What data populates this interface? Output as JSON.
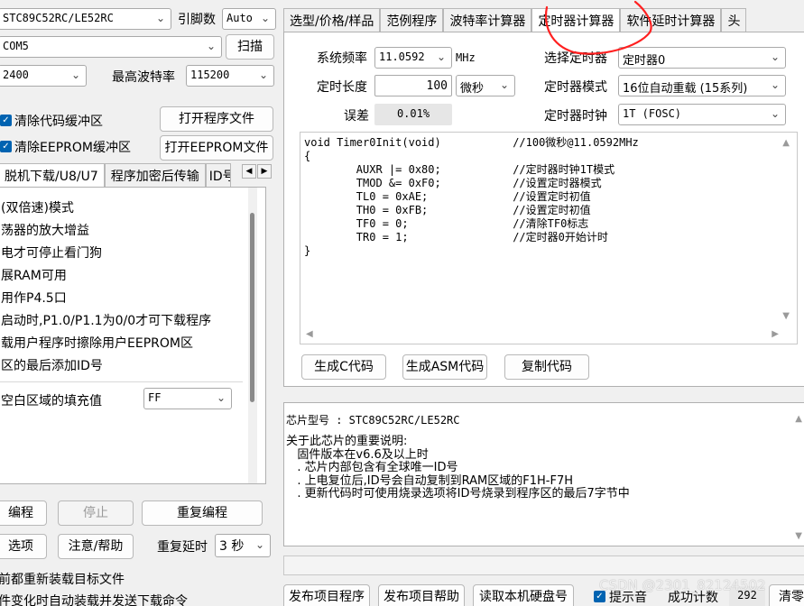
{
  "left": {
    "chip_select": "STC89C52RC/LE52RC",
    "pin_label": "引脚数",
    "pin_value": "Auto",
    "com_select": "COM5",
    "scan_button": "扫描",
    "baud_select": "2400",
    "max_baud_label": "最高波特率",
    "max_baud_value": "115200",
    "clear_code_label": "清除代码缓冲区",
    "clear_eeprom_label": "清除EEPROM缓冲区",
    "open_program_button": "打开程序文件",
    "open_eeprom_button": "打开EEPROM文件",
    "tabs": [
      "脱机下载/U8/U7",
      "程序加密后传输",
      "ID号"
    ],
    "options": [
      "(双倍速)模式",
      "荡器的放大增益",
      "电才可停止看门狗",
      "展RAM可用",
      "用作P4.5口",
      "启动时,P1.0/P1.1为0/0才可下载程序",
      "载用户程序时擦除用户EEPROM区",
      "区的最后添加ID号"
    ],
    "fill_label": "空白区域的填充值",
    "fill_value": "FF",
    "program_button": "编程",
    "stop_button": "停止",
    "reprogram_button": "重复编程",
    "options_button": "选项",
    "help_button": "注意/帮助",
    "repeat_delay_label": "重复延时",
    "repeat_delay_value": "3 秒",
    "note1": "前都重新装载目标文件",
    "note2": "件变化时自动装载并发送下载命令"
  },
  "right": {
    "tabs": [
      "选型/价格/样品",
      "范例程序",
      "波特率计算器",
      "定时器计算器",
      "软件延时计算器",
      "头"
    ],
    "active_tab": "定时器计算器",
    "sys_freq_label": "系统频率",
    "sys_freq_value": "11.0592",
    "sys_freq_unit": "MHz",
    "timer_select_label": "选择定时器",
    "timer_select_value": "定时器0",
    "timer_length_label": "定时长度",
    "timer_length_value": "100",
    "timer_length_unit": "微秒",
    "timer_mode_label": "定时器模式",
    "timer_mode_value": "16位自动重载 (15系列)",
    "error_label": "误差",
    "error_value": "0.01%",
    "timer_clock_label": "定时器时钟",
    "timer_clock_value": "1T  (FOSC)",
    "code": "void Timer0Init(void)           //100微秒@11.0592MHz\n{\n        AUXR |= 0x80;           //定时器时钟1T模式\n        TMOD &= 0xF0;           //设置定时器模式\n        TL0 = 0xAE;             //设置定时初值\n        TH0 = 0xFB;             //设置定时初值\n        TF0 = 0;                //清除TF0标志\n        TR0 = 1;                //定时器0开始计时\n}",
    "gen_c_button": "生成C代码",
    "gen_asm_button": "生成ASM代码",
    "copy_button": "复制代码",
    "info_title": "芯片型号 : STC89C52RC/LE52RC",
    "info_lines": [
      "关于此芯片的重要说明:",
      "   固件版本在v6.6及以上时",
      "   . 芯片内部包含有全球唯一ID号",
      "   . 上电复位后,ID号会自动复制到RAM区域的F1H-F7H",
      "   . 更新代码时可使用烧录选项将ID号烧录到程序区的最后7字节中"
    ]
  },
  "bottom": {
    "publish_program": "发布项目程序",
    "publish_help": "发布项目帮助",
    "read_disk": "读取本机硬盘号",
    "beep_label": "提示音",
    "success_label": "成功计数",
    "success_value": "292",
    "clear_button": "清零",
    "watermark": "CSDN @2301_82124502"
  },
  "annotation_color": "#ff2020"
}
